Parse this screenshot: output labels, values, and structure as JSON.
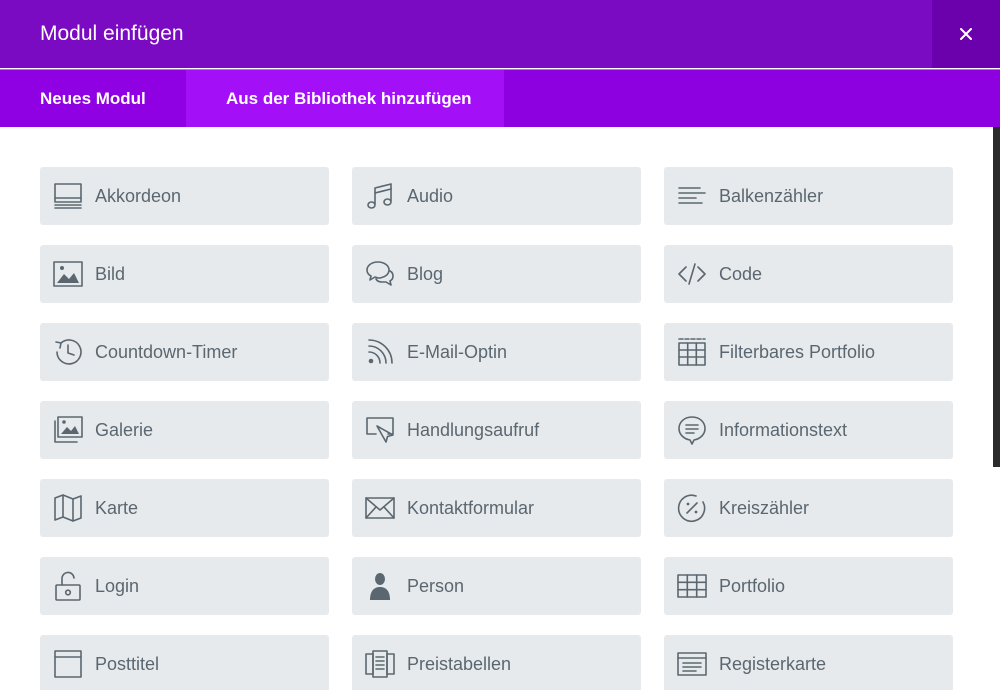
{
  "header": {
    "title": "Modul einfügen"
  },
  "close": {
    "icon": "close-icon"
  },
  "tabs": [
    {
      "label": "Neues Modul",
      "active": true
    },
    {
      "label": "Aus der Bibliothek hinzufügen",
      "active": false
    }
  ],
  "modules": [
    {
      "label": "Akkordeon",
      "icon": "accordion-icon"
    },
    {
      "label": "Audio",
      "icon": "music-note-icon"
    },
    {
      "label": "Balkenzähler",
      "icon": "bar-counter-icon"
    },
    {
      "label": "Bild",
      "icon": "image-icon"
    },
    {
      "label": "Blog",
      "icon": "chat-bubbles-icon"
    },
    {
      "label": "Code",
      "icon": "code-icon"
    },
    {
      "label": "Countdown-Timer",
      "icon": "history-clock-icon"
    },
    {
      "label": "E-Mail-Optin",
      "icon": "rss-icon"
    },
    {
      "label": "Filterbares Portfolio",
      "icon": "filter-grid-icon"
    },
    {
      "label": "Galerie",
      "icon": "gallery-icon"
    },
    {
      "label": "Handlungsaufruf",
      "icon": "cursor-screen-icon"
    },
    {
      "label": "Informationstext",
      "icon": "info-bubble-icon"
    },
    {
      "label": "Karte",
      "icon": "map-icon"
    },
    {
      "label": "Kontaktformular",
      "icon": "envelope-icon"
    },
    {
      "label": "Kreiszähler",
      "icon": "circle-percent-icon"
    },
    {
      "label": "Login",
      "icon": "unlock-icon"
    },
    {
      "label": "Person",
      "icon": "person-icon"
    },
    {
      "label": "Portfolio",
      "icon": "grid-icon"
    },
    {
      "label": "Posttitel",
      "icon": "window-icon"
    },
    {
      "label": "Preistabellen",
      "icon": "pricing-table-icon"
    },
    {
      "label": "Registerkarte",
      "icon": "tabs-icon"
    }
  ],
  "colors": {
    "header": "#7b0bc2",
    "tabbar": "#8d00e0",
    "tile": "#e6eaed",
    "text": "#5b6770"
  }
}
